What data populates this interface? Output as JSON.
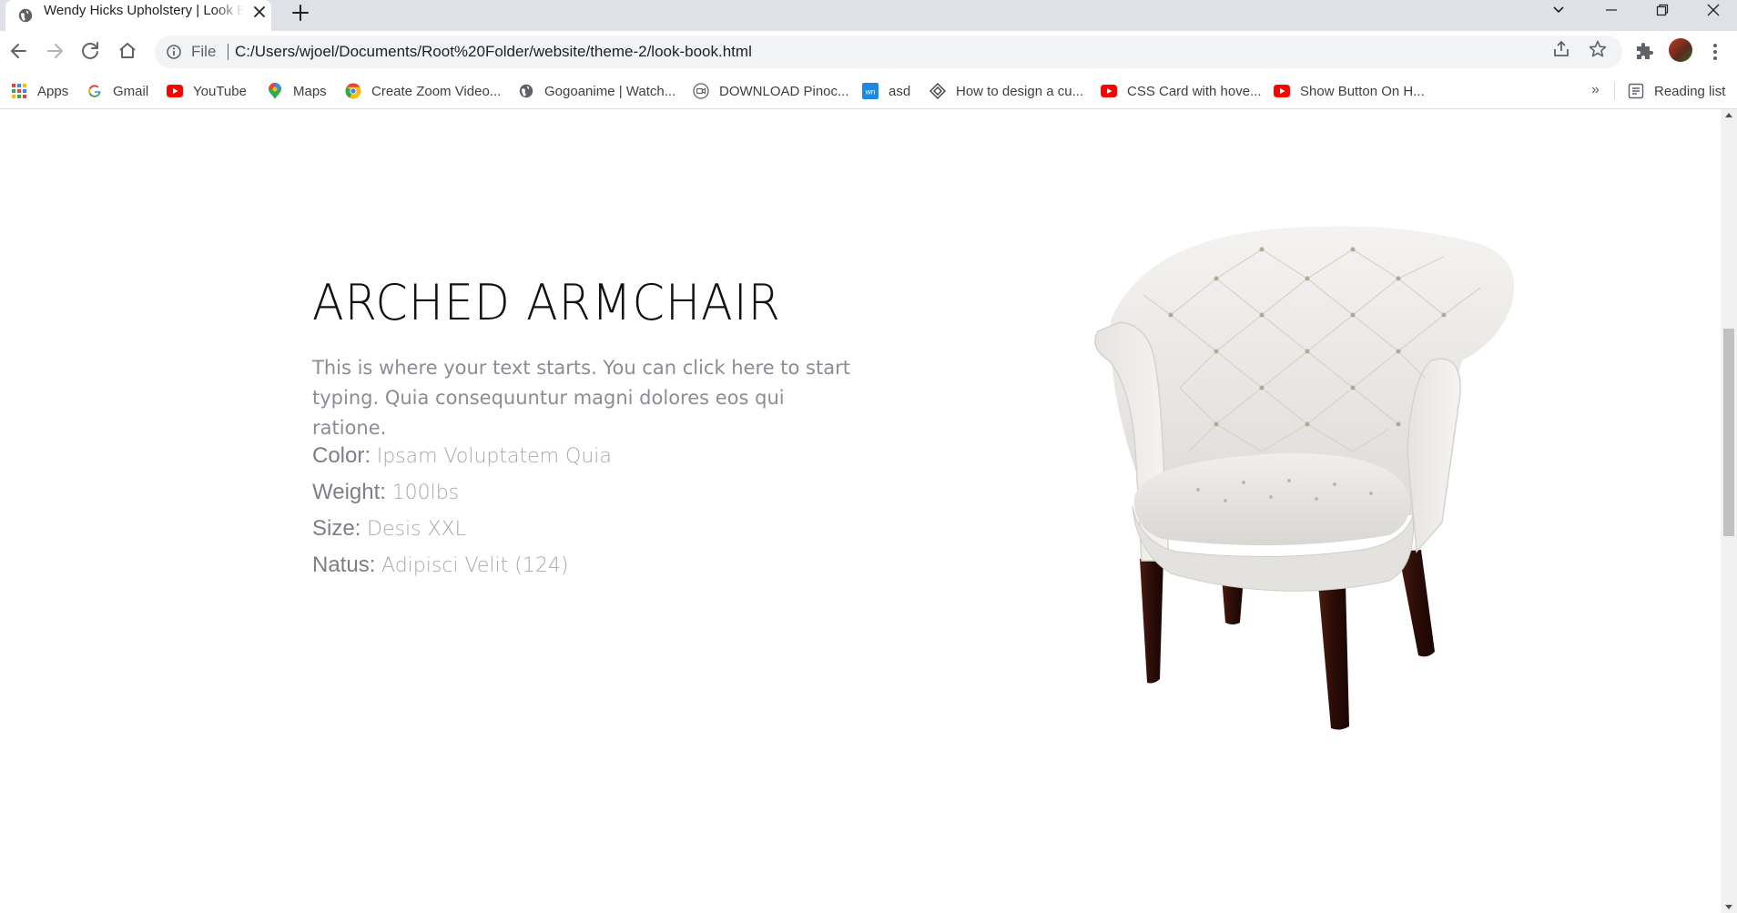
{
  "browser": {
    "tab_title": "Wendy Hicks Upholstery | Look Book",
    "address": {
      "scheme_label": "File",
      "url": "C:/Users/wjoel/Documents/Root%20Folder/website/theme-2/look-book.html"
    },
    "bookmarks": [
      {
        "label": "Apps",
        "icon": "apps-grid-icon"
      },
      {
        "label": "Gmail",
        "icon": "google-g-icon"
      },
      {
        "label": "YouTube",
        "icon": "youtube-icon"
      },
      {
        "label": "Maps",
        "icon": "maps-pin-icon"
      },
      {
        "label": "Create Zoom Video...",
        "icon": "chrome-icon"
      },
      {
        "label": "Gogoanime | Watch...",
        "icon": "globe-icon"
      },
      {
        "label": "DOWNLOAD Pinoc...",
        "icon": "camera-icon"
      },
      {
        "label": "asd",
        "icon": "wn-icon"
      },
      {
        "label": "How to design a cu...",
        "icon": "diamond-icon"
      },
      {
        "label": "CSS Card with hove...",
        "icon": "youtube-icon"
      },
      {
        "label": "Show Button On H...",
        "icon": "youtube-icon"
      }
    ],
    "more_bookmarks": "»",
    "reading_list": "Reading list"
  },
  "product": {
    "title": "ARCHED ARMCHAIR",
    "description": "This is where your text starts. You can click here to start typing. Quia consequuntur magni dolores eos qui ratione.",
    "specs": [
      {
        "key": "Color:",
        "value": "Ipsam Voluptatem Quia"
      },
      {
        "key": "Weight:",
        "value": "100lbs"
      },
      {
        "key": "Size:",
        "value": "Desis XXL"
      },
      {
        "key": "Natus:",
        "value": "Adipisci Velit (124)"
      }
    ]
  },
  "colors": {
    "chrome_frame": "#dee1e6",
    "omnibox": "#f1f3f4",
    "title_text": "#111111",
    "body_text": "#8a8d91",
    "youtube_red": "#ff0000"
  }
}
